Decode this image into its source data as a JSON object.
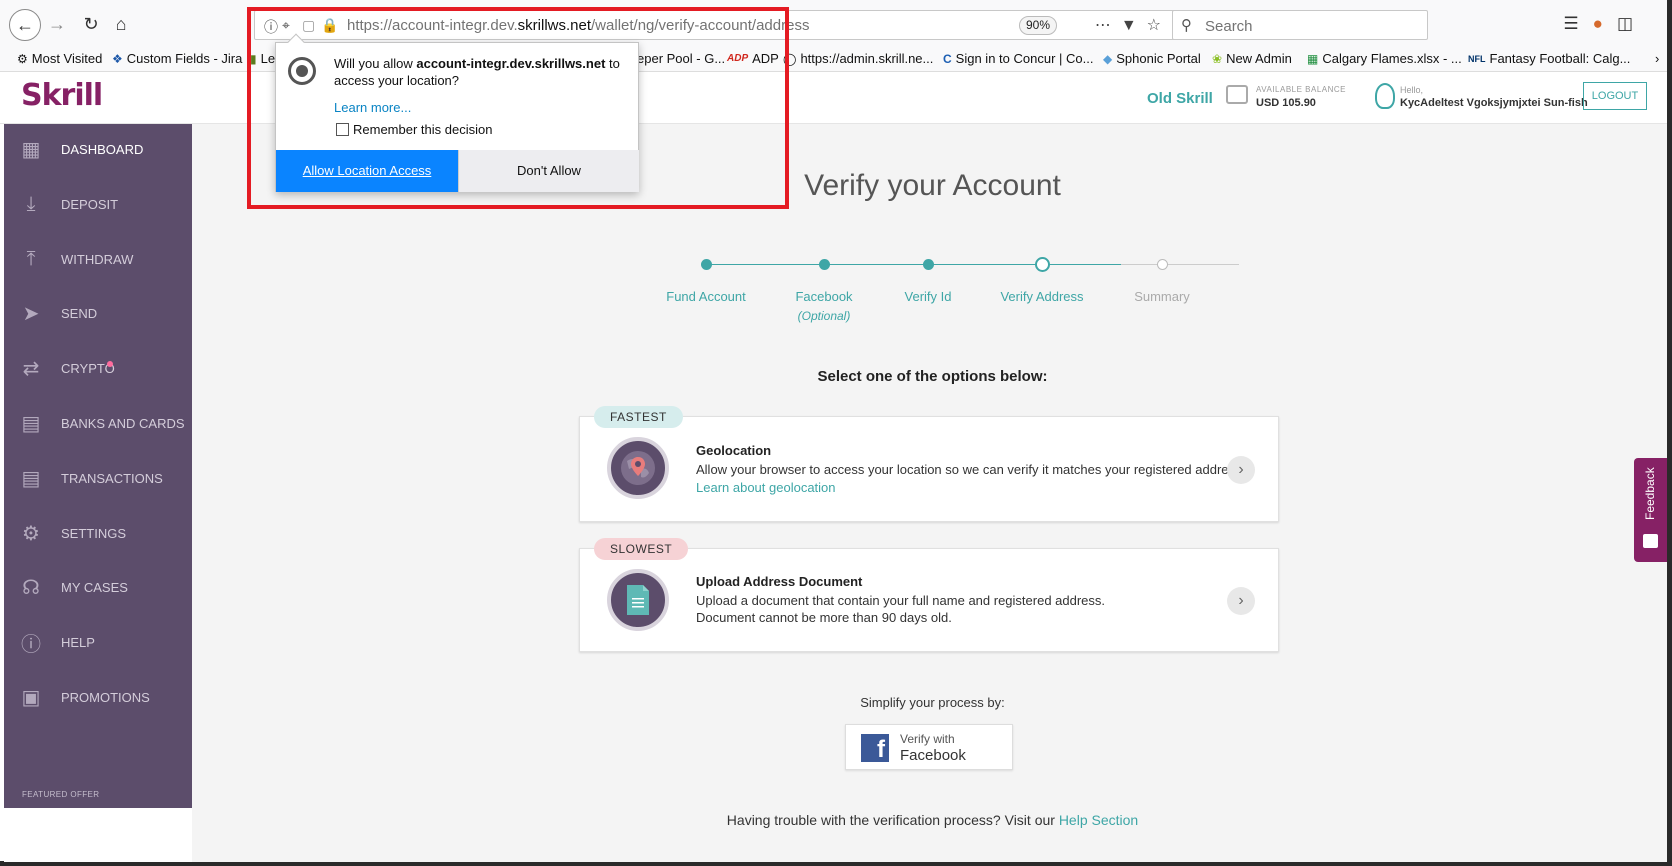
{
  "browser": {
    "url_prefix": "https://account-integr.dev.",
    "url_domain": "skrillws.net",
    "url_path": "/wallet/ng/verify-account/address",
    "zoom": "90%",
    "search_placeholder": "Search"
  },
  "bookmarks": [
    {
      "label": "Most Visited",
      "icon": "gear-icon"
    },
    {
      "label": "Custom Fields - Jira",
      "icon": "jira-icon"
    },
    {
      "label": "Le",
      "icon": "page-icon"
    },
    {
      "label": "eper Pool - G...",
      "icon": ""
    },
    {
      "label": "ADP",
      "icon": "adp-icon"
    },
    {
      "label": "https://admin.skrill.ne...",
      "icon": "globe-icon"
    },
    {
      "label": "Sign in to Concur | Co...",
      "icon": "concur-icon"
    },
    {
      "label": "Sphonic Portal",
      "icon": "cube-icon"
    },
    {
      "label": "New Admin",
      "icon": "leaf-icon"
    },
    {
      "label": "Calgary Flames.xlsx - ...",
      "icon": "sheet-icon"
    },
    {
      "label": "Fantasy Football: Calg...",
      "icon": "nfl-icon"
    }
  ],
  "permission_popup": {
    "question_prefix": "Will you allow ",
    "question_domain": "account-integr.dev.skrillws.net",
    "question_suffix": " to access your location?",
    "learn_more": "Learn more...",
    "remember_label": "Remember this decision",
    "allow_label": "Allow Location Access",
    "deny_label": "Don't Allow"
  },
  "header": {
    "logo": "Skrill",
    "old_skrill": "Old Skrill",
    "balance_label": "AVAILABLE BALANCE",
    "balance_value": "USD 105.90",
    "hello_label": "Hello,",
    "user_name": "KycAdeltest Vgoksjymjxtei Sun-fish",
    "logout_label": "LOGOUT"
  },
  "sidebar": {
    "items": [
      {
        "label": "DASHBOARD",
        "icon": "dashboard-icon"
      },
      {
        "label": "DEPOSIT",
        "icon": "deposit-icon"
      },
      {
        "label": "WITHDRAW",
        "icon": "withdraw-icon"
      },
      {
        "label": "SEND",
        "icon": "send-icon"
      },
      {
        "label": "CRYPTO",
        "icon": "crypto-icon"
      },
      {
        "label": "BANKS AND CARDS",
        "icon": "card-icon"
      },
      {
        "label": "TRANSACTIONS",
        "icon": "transactions-icon"
      },
      {
        "label": "SETTINGS",
        "icon": "gear-icon"
      },
      {
        "label": "MY CASES",
        "icon": "headset-icon"
      },
      {
        "label": "HELP",
        "icon": "help-icon"
      },
      {
        "label": "PROMOTIONS",
        "icon": "gift-icon"
      }
    ],
    "featured_label": "FEATURED OFFER"
  },
  "main": {
    "title": "Verify your Account",
    "steps": [
      {
        "label": "Fund Account",
        "state": "done"
      },
      {
        "label": "Facebook",
        "state": "done",
        "sub": "(Optional)"
      },
      {
        "label": "Verify Id",
        "state": "done"
      },
      {
        "label": "Verify Address",
        "state": "current"
      },
      {
        "label": "Summary",
        "state": "future"
      }
    ],
    "select_label": "Select one of the options below:",
    "options": [
      {
        "badge": "FASTEST",
        "badge_color": "#d6eded",
        "title": "Geolocation",
        "desc1": "Allow your browser to access your location so we can verify it matches your registered address.",
        "link": "Learn about geolocation",
        "icon": "globe-pin-icon"
      },
      {
        "badge": "SLOWEST",
        "badge_color": "#f6d2d5",
        "title": "Upload Address Document",
        "desc1": "Upload a document that contain your full name and registered address.",
        "desc2": "Document cannot be more than 90 days old.",
        "icon": "document-icon"
      }
    ],
    "simplify_label": "Simplify your process by:",
    "fb_top": "Verify with",
    "fb_bottom": "Facebook",
    "trouble_text": "Having trouble with the verification process? Visit our ",
    "help_link": "Help Section"
  },
  "feedback": {
    "label": "Feedback"
  },
  "colors": {
    "brand": "#862165",
    "accent": "#3ea6a6",
    "sidebar": "#5c4d6b",
    "allow_button": "#0a84ff",
    "highlight": "#e41b23"
  }
}
